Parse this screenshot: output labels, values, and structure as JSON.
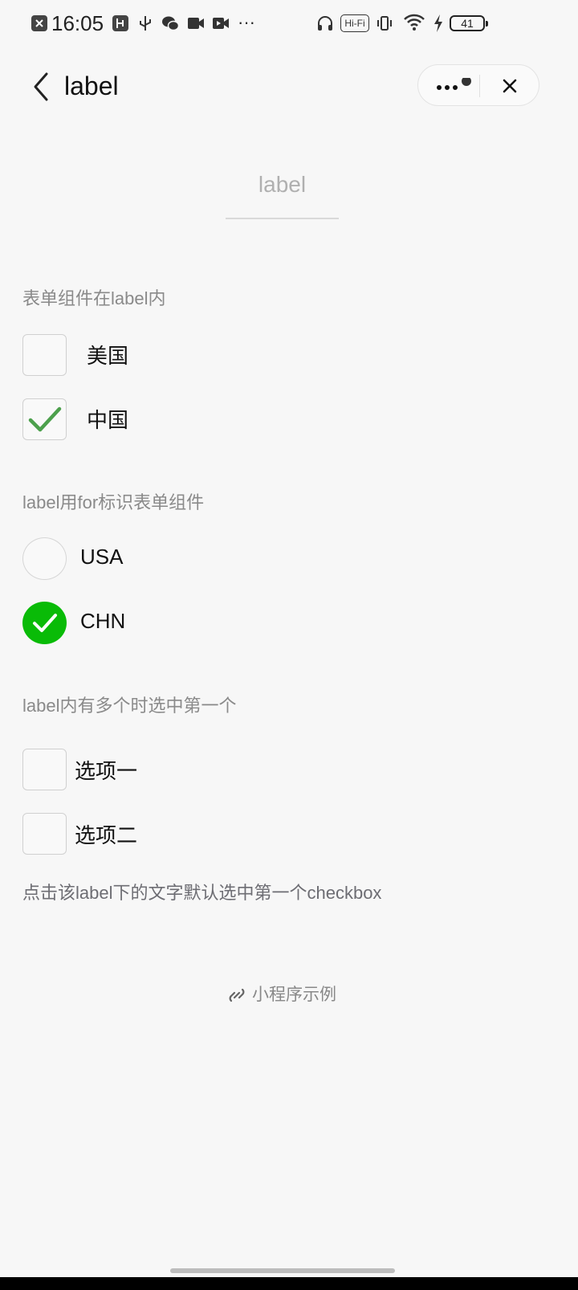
{
  "status_bar": {
    "time": "16:05",
    "hifi": "Hi-Fi",
    "battery": "41",
    "overflow": "···",
    "icons": [
      "close-box-icon",
      "usb-box-icon",
      "usb-icon",
      "wechat-icon",
      "video-icon",
      "camera-icon",
      "headphones-icon",
      "vibrate-icon",
      "wifi-icon",
      "charging-icon"
    ]
  },
  "nav": {
    "title": "label",
    "icons": [
      "back-icon",
      "more-icon",
      "close-icon"
    ]
  },
  "page_head": "label",
  "sections": [
    {
      "title": "表单组件在label内",
      "type": "checkbox",
      "options": [
        {
          "label": "美国",
          "checked": false
        },
        {
          "label": "中国",
          "checked": true
        }
      ]
    },
    {
      "title": "label用for标识表单组件",
      "type": "radio",
      "options": [
        {
          "label": "USA",
          "checked": false
        },
        {
          "label": "CHN",
          "checked": true
        }
      ]
    },
    {
      "title": "label内有多个时选中第一个",
      "type": "checkbox",
      "options": [
        {
          "label": "选项一",
          "checked": false
        },
        {
          "label": "选项二",
          "checked": false
        }
      ]
    }
  ],
  "note": "点击该label下的文字默认选中第一个checkbox",
  "footer": "小程序示例",
  "colors": {
    "accent_green": "#09bb07",
    "check_green": "#4ca04c",
    "background": "#f7f7f7"
  }
}
